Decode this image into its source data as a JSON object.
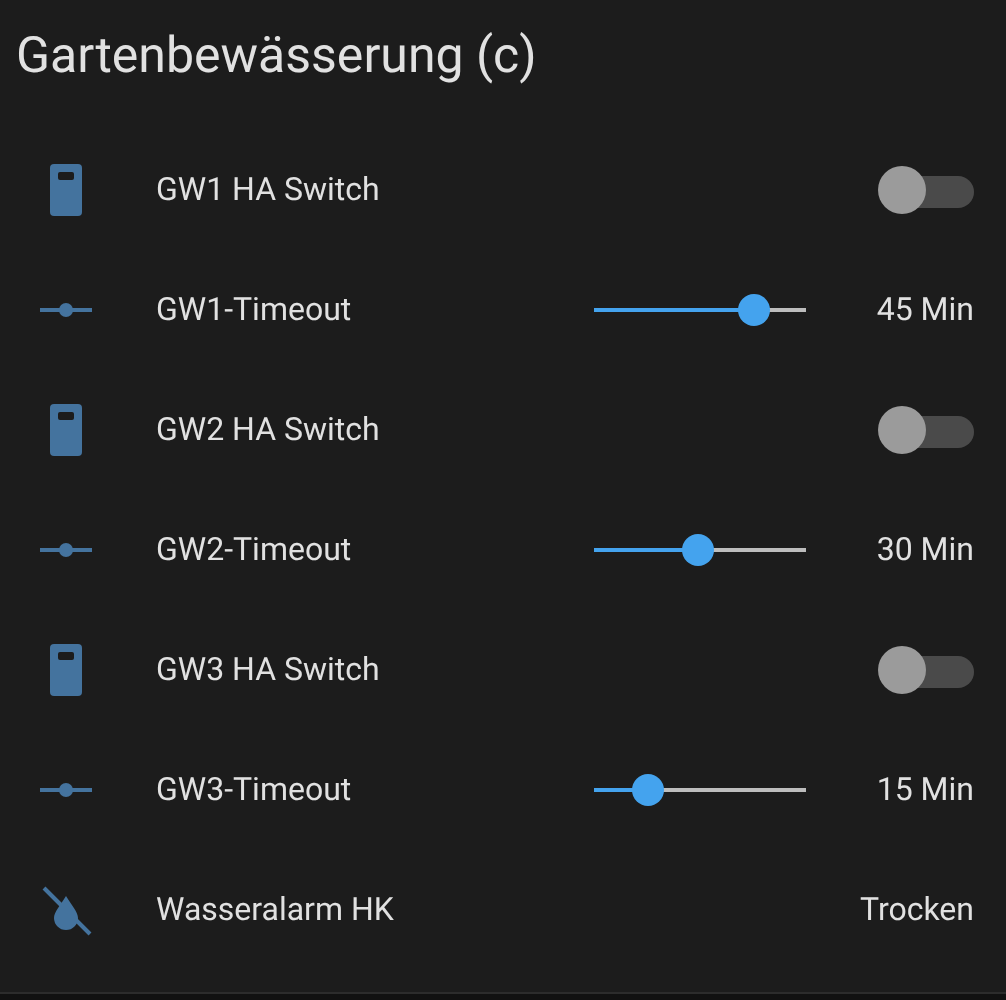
{
  "card": {
    "title": "Gartenbewässerung (c)"
  },
  "rows": [
    {
      "kind": "switch",
      "label": "GW1 HA Switch",
      "on": false
    },
    {
      "kind": "slider",
      "label": "GW1-Timeout",
      "level": 0.75,
      "reading": "45 Min"
    },
    {
      "kind": "switch",
      "label": "GW2 HA Switch",
      "on": false
    },
    {
      "kind": "slider",
      "label": "GW2-Timeout",
      "level": 0.49,
      "reading": "30 Min"
    },
    {
      "kind": "switch",
      "label": "GW3 HA Switch",
      "on": false
    },
    {
      "kind": "slider",
      "label": "GW3-Timeout",
      "level": 0.25,
      "reading": "15 Min"
    },
    {
      "kind": "sensor",
      "label": "Wasseralarm HK",
      "value": "Trocken"
    }
  ]
}
